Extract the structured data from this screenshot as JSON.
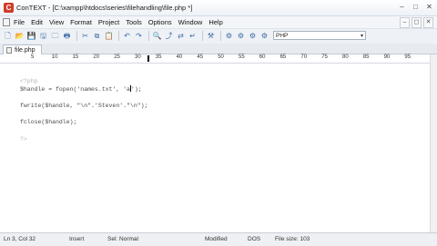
{
  "app": {
    "window_title": "ConTEXT - [C:\\xampp\\htdocs\\series\\filehandling\\file.php *]",
    "app_icon_letter": "C"
  },
  "window_controls": [
    "–",
    "□",
    "✕"
  ],
  "menu": [
    "File",
    "Edit",
    "View",
    "Format",
    "Project",
    "Tools",
    "Options",
    "Window",
    "Help"
  ],
  "menu_controls": [
    "–",
    "◻",
    "✕"
  ],
  "toolbar": {
    "language": "PHP",
    "buttons": [
      {
        "name": "new-file-icon",
        "glyph": "🗋"
      },
      {
        "name": "open-file-icon",
        "glyph": "📂"
      },
      {
        "name": "save-icon",
        "glyph": "💾"
      },
      {
        "name": "save-all-icon",
        "glyph": "🖫"
      },
      {
        "name": "close-file-icon",
        "glyph": "🗀"
      },
      {
        "name": "print-icon",
        "glyph": "🖶"
      },
      {
        "name": "cut-icon",
        "glyph": "✂"
      },
      {
        "name": "copy-icon",
        "glyph": "⧉"
      },
      {
        "name": "paste-icon",
        "glyph": "📋"
      },
      {
        "name": "undo-icon",
        "glyph": "↶"
      },
      {
        "name": "redo-icon",
        "glyph": "↷"
      },
      {
        "name": "find-icon",
        "glyph": "🔍"
      },
      {
        "name": "find-next-icon",
        "glyph": "⤴"
      },
      {
        "name": "replace-icon",
        "glyph": "⇄"
      },
      {
        "name": "word-wrap-icon",
        "glyph": "↵"
      },
      {
        "name": "tools-icon",
        "glyph": "⚒"
      },
      {
        "name": "run-1-icon",
        "glyph": "⚙"
      },
      {
        "name": "run-2-icon",
        "glyph": "⚙"
      },
      {
        "name": "run-3-icon",
        "glyph": "⚙"
      },
      {
        "name": "run-4-icon",
        "glyph": "⚙"
      }
    ]
  },
  "tab": {
    "label": "file.php"
  },
  "ruler": {
    "numbers": [
      "5",
      "10",
      "15",
      "20",
      "25",
      "30",
      "35",
      "40",
      "45",
      "50",
      "55",
      "60",
      "65",
      "70",
      "75",
      "80",
      "85",
      "90",
      "95"
    ]
  },
  "code": {
    "line1": "<?php",
    "line2_a": "$handle = fopen('names.txt', 'a",
    "line2_b": "');",
    "line3": "fwrite($handle, \"\\n\".'Steven'.\"\\n\");",
    "line4": "fclose($handle);",
    "line5": "?>"
  },
  "status": {
    "position": "Ln 3, Col 32",
    "mode": "Insert",
    "selection": "Sel: Normal",
    "state": "Modified",
    "format": "DOS",
    "filesize": "File size: 103"
  },
  "colors": {
    "caret": "#000000",
    "toolbar_bg": "#eef1f5",
    "status_bg": "#eef0f3"
  }
}
